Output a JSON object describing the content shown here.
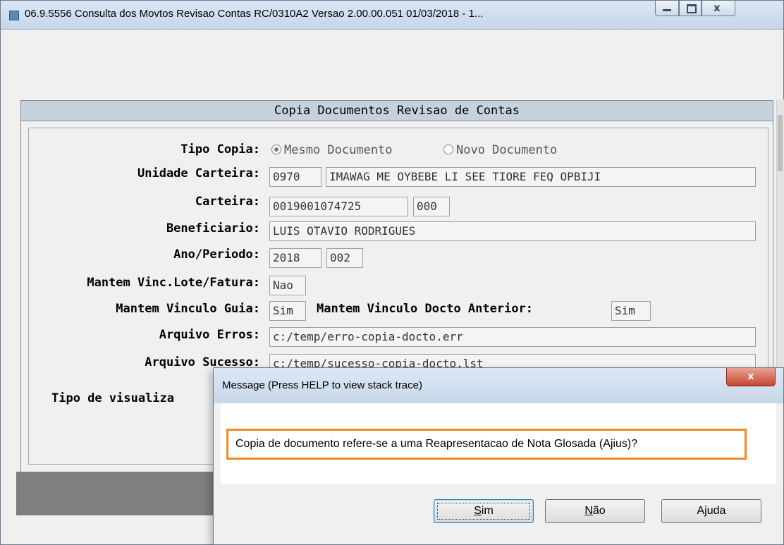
{
  "window": {
    "title": "06.9.5556 Consulta  dos Movtos Revisao Contas RC/0310A2 Versao 2.00.00.051 01/03/2018 - 1...",
    "controls": {
      "minimize": "",
      "maximize": "",
      "close": "x"
    }
  },
  "form": {
    "header": "Copia Documentos Revisao de Contas",
    "tipo_copia": {
      "label": "Tipo Copia:",
      "options": [
        {
          "label": "Mesmo Documento",
          "selected": true
        },
        {
          "label": "Novo Documento",
          "selected": false
        }
      ]
    },
    "unidade_carteira": {
      "label": "Unidade Carteira:",
      "code": "0970",
      "name": "IMAWAG ME OYBEBE LI SEE TIORE FEQ OPBIJI"
    },
    "carteira": {
      "label": "Carteira:",
      "number": "0019001074725",
      "suffix": "000"
    },
    "beneficiario": {
      "label": "Beneficiario:",
      "value": "LUIS OTAVIO RODRIGUES"
    },
    "ano_periodo": {
      "label": "Ano/Periodo:",
      "ano": "2018",
      "periodo": "002"
    },
    "mantem_vinc_lote": {
      "label": "Mantem Vinc.Lote/Fatura:",
      "value": "Nao"
    },
    "mantem_vinculo_guia": {
      "label": "Mantem Vinculo Guia:",
      "value": "Sim"
    },
    "mantem_vinculo_docto": {
      "label": "Mantem Vinculo Docto Anterior:",
      "value": "Sim"
    },
    "arquivo_erros": {
      "label": "Arquivo Erros:",
      "value": "c:/temp/erro-copia-docto.err"
    },
    "arquivo_sucesso": {
      "label": "Arquivo Sucesso:",
      "value": "c:/temp/sucesso-copia-docto.lst"
    },
    "tipo_visualiza": {
      "label": "Tipo de visualiza"
    }
  },
  "dialog": {
    "title": "Message (Press HELP to view stack trace)",
    "close": "x",
    "message": "Copia de documento refere-se a uma Reapresentacao de Nota Glosada (Ajius)?",
    "buttons": {
      "sim": {
        "accel": "S",
        "rest": "im"
      },
      "nao": {
        "accel": "N",
        "rest": "ão"
      },
      "ajuda": "Ajuda"
    }
  },
  "colors": {
    "highlight_border": "#f08a24",
    "close_button": "#c6452f"
  }
}
